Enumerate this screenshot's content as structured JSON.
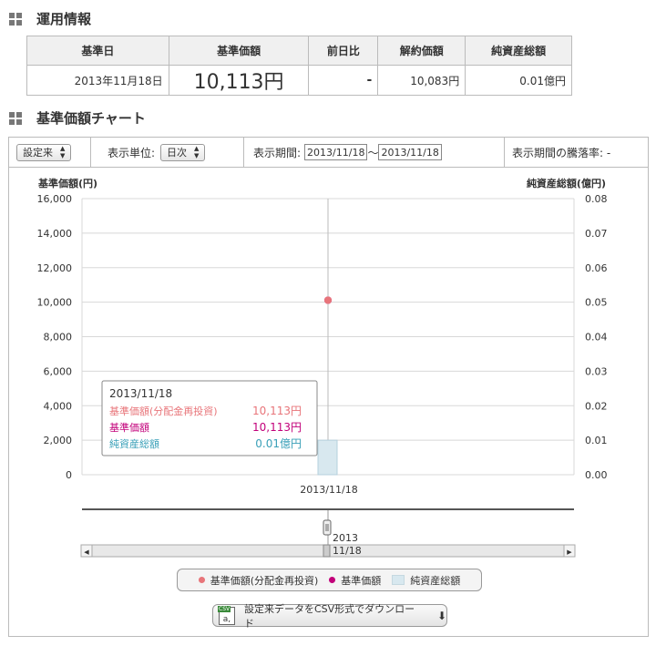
{
  "section1": {
    "title": "運用情報"
  },
  "info_table": {
    "headers": [
      "基準日",
      "基準価額",
      "前日比",
      "解約価額",
      "純資産総額"
    ],
    "date": "2013年11月18日",
    "nav": "10,113円",
    "change": "-",
    "redemption": "10,083円",
    "net_assets": "0.01億円"
  },
  "section2": {
    "title": "基準価額チャート"
  },
  "toolbar": {
    "fund_select": "設定来",
    "unit_label": "表示単位:",
    "unit_select": "日次",
    "period_label": "表示期間:",
    "period_from": "2013/11/18",
    "period_sep": "〜",
    "period_to": "2013/11/18",
    "change_rate": "表示期間の騰落率: -"
  },
  "chart_data": {
    "type": "bar",
    "x": [
      "2013/11/18"
    ],
    "left_axis": {
      "label": "基準価額(円)",
      "ylim": [
        0,
        16000
      ],
      "ticks": [
        "16,000",
        "14,000",
        "12,000",
        "10,000",
        "8,000",
        "6,000",
        "4,000",
        "2,000",
        "0"
      ]
    },
    "right_axis": {
      "label": "純資産総額(億円)",
      "ylim": [
        0,
        0.08
      ],
      "ticks": [
        "0.08",
        "0.07",
        "0.06",
        "0.05",
        "0.04",
        "0.03",
        "0.02",
        "0.01",
        "0.00"
      ]
    },
    "series": [
      {
        "name": "基準価額(分配金再投資)",
        "type": "scatter",
        "axis": "left",
        "values": [
          10113
        ],
        "color": "#e8757a"
      },
      {
        "name": "基準価額",
        "type": "scatter",
        "axis": "left",
        "values": [
          10113
        ],
        "color": "#c2007a"
      },
      {
        "name": "純資産総額",
        "type": "bar",
        "axis": "right",
        "values": [
          0.01
        ],
        "color": "#d8e8ef"
      }
    ],
    "tooltip": {
      "date": "2013/11/18",
      "rows": [
        {
          "label": "基準価額(分配金再投資)",
          "value": "10,113円",
          "color": "#e8757a"
        },
        {
          "label": "基準価額",
          "value": "10,113円",
          "color": "#c2007a"
        },
        {
          "label": "純資産総額",
          "value": "0.01億円",
          "color": "#3aa0b8"
        }
      ]
    },
    "x_tick_label": "2013/11/18",
    "grid": true
  },
  "navigator": {
    "year_label": "2013",
    "date_label": "11/18"
  },
  "legend": {
    "items": [
      "基準価額(分配金再投資)",
      "基準価額",
      "純資産総額"
    ]
  },
  "csv": {
    "label": "設定来データをCSV形式でダウンロード",
    "icon_tag": "CSV",
    "icon_letter": "a,"
  }
}
